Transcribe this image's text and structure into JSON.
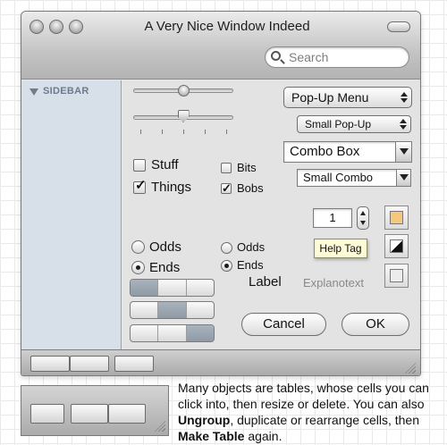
{
  "window": {
    "title": "A Very Nice Window Indeed",
    "search_placeholder": "Search"
  },
  "sidebar": {
    "header": "SIDEBAR"
  },
  "sliders": [
    {
      "name": "slider-top",
      "value": 0.5
    },
    {
      "name": "slider-ticked",
      "value": 0.5
    }
  ],
  "popups": {
    "popup_menu": "Pop-Up Menu",
    "small_popup": "Small Pop-Up",
    "combo_box": "Combo Box",
    "small_combo": "Small Combo"
  },
  "checkboxes": {
    "stuff": {
      "label": "Stuff",
      "checked": false
    },
    "things": {
      "label": "Things",
      "checked": true
    },
    "bits": {
      "label": "Bits",
      "checked": false
    },
    "bobs": {
      "label": "Bobs",
      "checked": true
    }
  },
  "radios": {
    "large": [
      {
        "label": "Odds",
        "selected": false
      },
      {
        "label": "Ends",
        "selected": true
      }
    ],
    "small": [
      {
        "label": "Odds",
        "selected": false
      },
      {
        "label": "Ends",
        "selected": true
      }
    ]
  },
  "stepper": {
    "value": "1"
  },
  "help_tag": "Help Tag",
  "label": "Label",
  "explanotext": "Explanotext",
  "color_wells": [
    "#f6c97a",
    "black-white-split",
    "#ececec"
  ],
  "buttons": {
    "cancel": "Cancel",
    "ok": "OK"
  },
  "note": {
    "part1": "Many objects are tables, whose cells you can click into, then resize or delete. You can also ",
    "ungroup": "Ungroup",
    "part2": ", duplicate or rearrange cells, then ",
    "make_table": "Make Table",
    "part3": " again."
  }
}
